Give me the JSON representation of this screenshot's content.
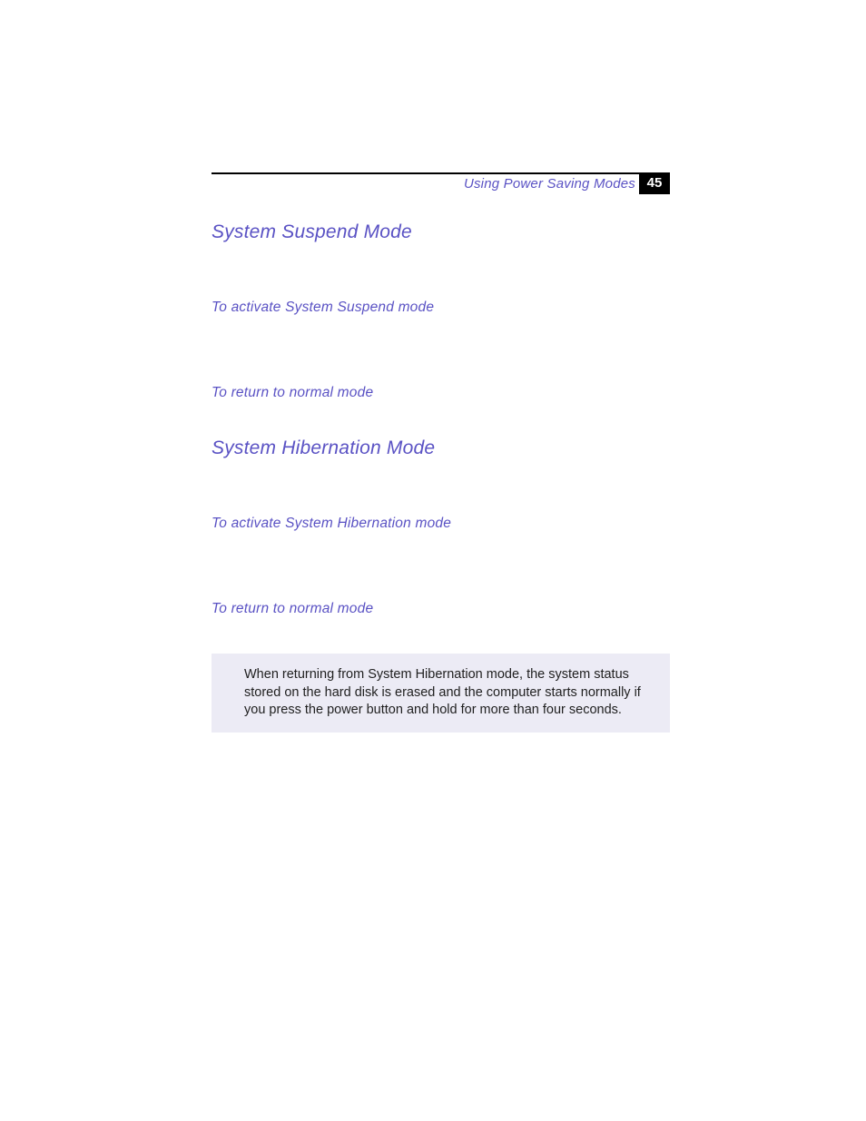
{
  "header": {
    "running_title": "Using Power Saving Modes",
    "page_number": "45"
  },
  "sections": {
    "suspend": {
      "title": "System Suspend Mode",
      "activate": "To activate System Suspend mode",
      "return": "To return to normal mode"
    },
    "hibernation": {
      "title": "System Hibernation Mode",
      "activate": "To activate System Hibernation mode",
      "return": "To return to normal mode"
    }
  },
  "note": "When returning from System Hibernation mode, the system status stored on the hard disk is erased and the computer starts normally if you press the power button and hold for more than four seconds."
}
